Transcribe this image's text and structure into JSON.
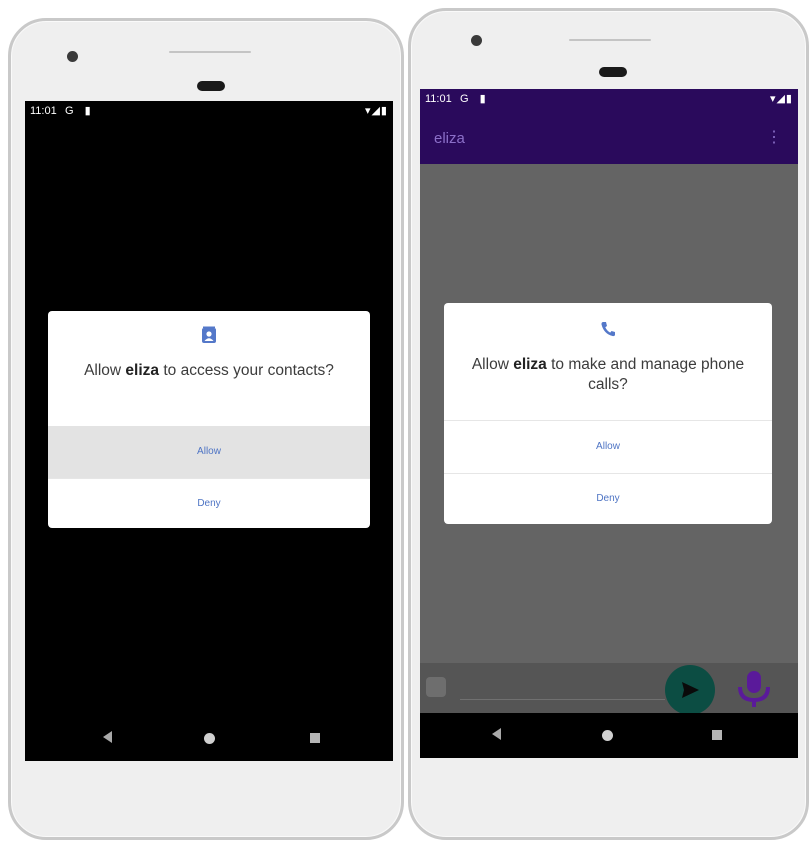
{
  "left_phone": {
    "status": {
      "time": "11:01",
      "left_icons": "G ▮",
      "right_icons": "▾◢▮"
    },
    "dialog": {
      "icon": "contacts-icon",
      "prefix": "Allow ",
      "app_name": "eliza",
      "suffix": " to access your contacts?",
      "allow_label": "Allow",
      "deny_label": "Deny"
    }
  },
  "right_phone": {
    "status": {
      "time": "11:01",
      "left_icons": "G ▮",
      "right_icons": "▾◢▮"
    },
    "app_bar": {
      "title": "eliza",
      "menu_icon": "overflow-menu-icon"
    },
    "dialog": {
      "icon": "phone-icon",
      "prefix": "Allow ",
      "app_name": "eliza",
      "suffix": " to make and manage phone calls?",
      "allow_label": "Allow",
      "deny_label": "Deny"
    },
    "input_bar": {
      "send_icon": "send-icon",
      "mic_icon": "microphone-icon"
    }
  },
  "colors": {
    "app_bar": "#2a0a5c",
    "accent_link": "#4e74c4",
    "fab": "#0c4d43",
    "mic": "#5a1a9a"
  }
}
